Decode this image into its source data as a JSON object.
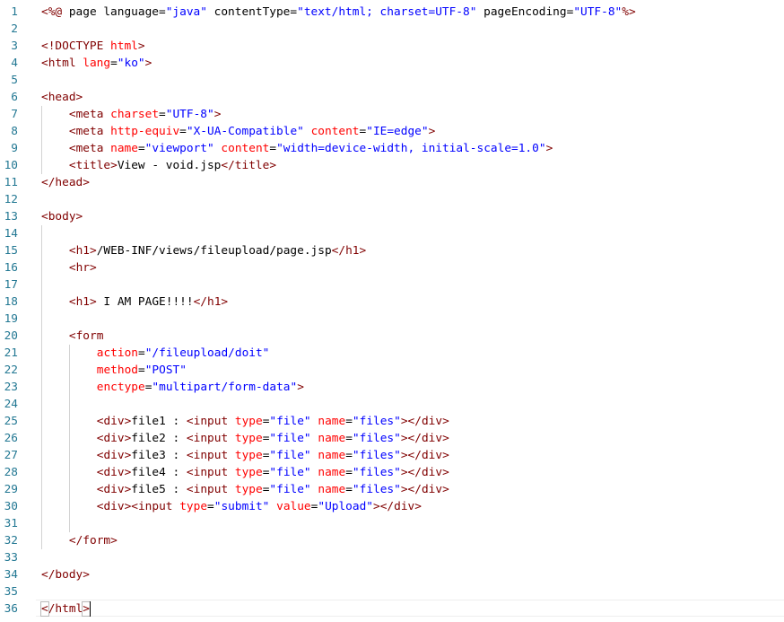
{
  "lines": [
    {
      "n": "1",
      "indent": 0,
      "tokens": [
        [
          "t",
          "<%@ "
        ],
        [
          "p",
          "page language="
        ],
        [
          "v",
          "\"java\""
        ],
        [
          "p",
          " contentType="
        ],
        [
          "v",
          "\"text/html; charset=UTF-8\""
        ],
        [
          "p",
          " pageEncoding="
        ],
        [
          "v",
          "\"UTF-8\""
        ],
        [
          "t",
          "%>"
        ]
      ]
    },
    {
      "n": "2",
      "indent": 0,
      "tokens": []
    },
    {
      "n": "3",
      "indent": 0,
      "tokens": [
        [
          "t",
          "<!DOCTYPE "
        ],
        [
          "a",
          "html"
        ],
        [
          "t",
          ">"
        ]
      ]
    },
    {
      "n": "4",
      "indent": 0,
      "tokens": [
        [
          "t",
          "<html "
        ],
        [
          "a",
          "lang"
        ],
        [
          "p",
          "="
        ],
        [
          "v",
          "\"ko\""
        ],
        [
          "t",
          ">"
        ]
      ]
    },
    {
      "n": "5",
      "indent": 0,
      "tokens": []
    },
    {
      "n": "6",
      "indent": 0,
      "tokens": [
        [
          "t",
          "<head>"
        ]
      ]
    },
    {
      "n": "7",
      "indent": 1,
      "tokens": [
        [
          "t",
          "<meta "
        ],
        [
          "a",
          "charset"
        ],
        [
          "p",
          "="
        ],
        [
          "v",
          "\"UTF-8\""
        ],
        [
          "t",
          ">"
        ]
      ]
    },
    {
      "n": "8",
      "indent": 1,
      "tokens": [
        [
          "t",
          "<meta "
        ],
        [
          "a",
          "http-equiv"
        ],
        [
          "p",
          "="
        ],
        [
          "v",
          "\"X-UA-Compatible\""
        ],
        [
          "p",
          " "
        ],
        [
          "a",
          "content"
        ],
        [
          "p",
          "="
        ],
        [
          "v",
          "\"IE=edge\""
        ],
        [
          "t",
          ">"
        ]
      ]
    },
    {
      "n": "9",
      "indent": 1,
      "tokens": [
        [
          "t",
          "<meta "
        ],
        [
          "a",
          "name"
        ],
        [
          "p",
          "="
        ],
        [
          "v",
          "\"viewport\""
        ],
        [
          "p",
          " "
        ],
        [
          "a",
          "content"
        ],
        [
          "p",
          "="
        ],
        [
          "v",
          "\"width=device-width, initial-scale=1.0\""
        ],
        [
          "t",
          ">"
        ]
      ]
    },
    {
      "n": "10",
      "indent": 1,
      "tokens": [
        [
          "t",
          "<title>"
        ],
        [
          "p",
          "View - void.jsp"
        ],
        [
          "t",
          "</title>"
        ]
      ]
    },
    {
      "n": "11",
      "indent": 0,
      "tokens": [
        [
          "t",
          "</head>"
        ]
      ]
    },
    {
      "n": "12",
      "indent": 0,
      "tokens": []
    },
    {
      "n": "13",
      "indent": 0,
      "tokens": [
        [
          "t",
          "<body>"
        ]
      ]
    },
    {
      "n": "14",
      "indent": 0,
      "tokens": []
    },
    {
      "n": "15",
      "indent": 1,
      "tokens": [
        [
          "t",
          "<h1>"
        ],
        [
          "p",
          "/WEB-INF/views/fileupload/page.jsp"
        ],
        [
          "t",
          "</h1>"
        ]
      ]
    },
    {
      "n": "16",
      "indent": 1,
      "tokens": [
        [
          "t",
          "<hr>"
        ]
      ]
    },
    {
      "n": "17",
      "indent": 0,
      "tokens": []
    },
    {
      "n": "18",
      "indent": 1,
      "tokens": [
        [
          "t",
          "<h1>"
        ],
        [
          "p",
          " I AM PAGE!!!!"
        ],
        [
          "t",
          "</h1>"
        ]
      ]
    },
    {
      "n": "19",
      "indent": 0,
      "tokens": []
    },
    {
      "n": "20",
      "indent": 1,
      "tokens": [
        [
          "t",
          "<form"
        ]
      ]
    },
    {
      "n": "21",
      "indent": 2,
      "tokens": [
        [
          "a",
          "action"
        ],
        [
          "p",
          "="
        ],
        [
          "v",
          "\"/fileupload/doit\""
        ]
      ]
    },
    {
      "n": "22",
      "indent": 2,
      "tokens": [
        [
          "a",
          "method"
        ],
        [
          "p",
          "="
        ],
        [
          "v",
          "\"POST\""
        ]
      ]
    },
    {
      "n": "23",
      "indent": 2,
      "tokens": [
        [
          "a",
          "enctype"
        ],
        [
          "p",
          "="
        ],
        [
          "v",
          "\"multipart/form-data\""
        ],
        [
          "t",
          ">"
        ]
      ]
    },
    {
      "n": "24",
      "indent": 0,
      "tokens": []
    },
    {
      "n": "25",
      "indent": 2,
      "tokens": [
        [
          "t",
          "<div>"
        ],
        [
          "p",
          "file1 : "
        ],
        [
          "t",
          "<input "
        ],
        [
          "a",
          "type"
        ],
        [
          "p",
          "="
        ],
        [
          "v",
          "\"file\""
        ],
        [
          "p",
          " "
        ],
        [
          "a",
          "name"
        ],
        [
          "p",
          "="
        ],
        [
          "v",
          "\"files\""
        ],
        [
          "t",
          "></div>"
        ]
      ]
    },
    {
      "n": "26",
      "indent": 2,
      "tokens": [
        [
          "t",
          "<div>"
        ],
        [
          "p",
          "file2 : "
        ],
        [
          "t",
          "<input "
        ],
        [
          "a",
          "type"
        ],
        [
          "p",
          "="
        ],
        [
          "v",
          "\"file\""
        ],
        [
          "p",
          " "
        ],
        [
          "a",
          "name"
        ],
        [
          "p",
          "="
        ],
        [
          "v",
          "\"files\""
        ],
        [
          "t",
          "></div>"
        ]
      ]
    },
    {
      "n": "27",
      "indent": 2,
      "tokens": [
        [
          "t",
          "<div>"
        ],
        [
          "p",
          "file3 : "
        ],
        [
          "t",
          "<input "
        ],
        [
          "a",
          "type"
        ],
        [
          "p",
          "="
        ],
        [
          "v",
          "\"file\""
        ],
        [
          "p",
          " "
        ],
        [
          "a",
          "name"
        ],
        [
          "p",
          "="
        ],
        [
          "v",
          "\"files\""
        ],
        [
          "t",
          "></div>"
        ]
      ]
    },
    {
      "n": "28",
      "indent": 2,
      "tokens": [
        [
          "t",
          "<div>"
        ],
        [
          "p",
          "file4 : "
        ],
        [
          "t",
          "<input "
        ],
        [
          "a",
          "type"
        ],
        [
          "p",
          "="
        ],
        [
          "v",
          "\"file\""
        ],
        [
          "p",
          " "
        ],
        [
          "a",
          "name"
        ],
        [
          "p",
          "="
        ],
        [
          "v",
          "\"files\""
        ],
        [
          "t",
          "></div>"
        ]
      ]
    },
    {
      "n": "29",
      "indent": 2,
      "tokens": [
        [
          "t",
          "<div>"
        ],
        [
          "p",
          "file5 : "
        ],
        [
          "t",
          "<input "
        ],
        [
          "a",
          "type"
        ],
        [
          "p",
          "="
        ],
        [
          "v",
          "\"file\""
        ],
        [
          "p",
          " "
        ],
        [
          "a",
          "name"
        ],
        [
          "p",
          "="
        ],
        [
          "v",
          "\"files\""
        ],
        [
          "t",
          "></div>"
        ]
      ]
    },
    {
      "n": "30",
      "indent": 2,
      "tokens": [
        [
          "t",
          "<div><input "
        ],
        [
          "a",
          "type"
        ],
        [
          "p",
          "="
        ],
        [
          "v",
          "\"submit\""
        ],
        [
          "p",
          " "
        ],
        [
          "a",
          "value"
        ],
        [
          "p",
          "="
        ],
        [
          "v",
          "\"Upload\""
        ],
        [
          "t",
          "></div>"
        ]
      ]
    },
    {
      "n": "31",
      "indent": 0,
      "tokens": []
    },
    {
      "n": "32",
      "indent": 1,
      "tokens": [
        [
          "t",
          "</form>"
        ]
      ]
    },
    {
      "n": "33",
      "indent": 0,
      "tokens": []
    },
    {
      "n": "34",
      "indent": 0,
      "tokens": [
        [
          "t",
          "</body>"
        ]
      ]
    },
    {
      "n": "35",
      "indent": 0,
      "tokens": []
    },
    {
      "n": "36",
      "indent": 0,
      "tokens": [
        [
          "t",
          "</html>"
        ]
      ]
    }
  ],
  "colors": {
    "tag": "#800000",
    "attribute": "#ff0000",
    "value": "#0000ff",
    "text": "#000000",
    "line_number": "#237893",
    "indent_guide": "#d3d3d3"
  }
}
